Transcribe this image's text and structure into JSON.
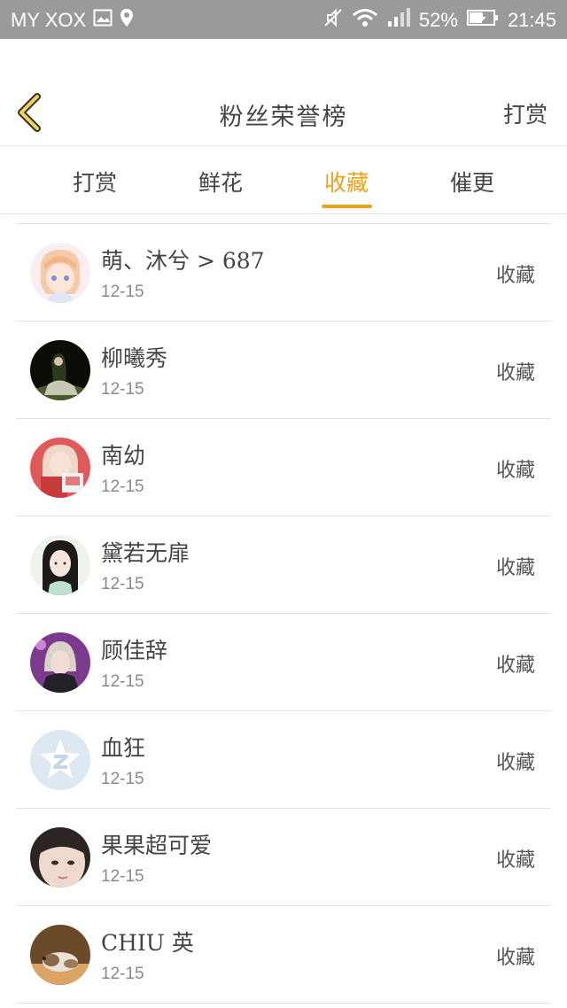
{
  "status_bar": {
    "carrier": "MY XOX",
    "battery": "52%",
    "time": "21:45",
    "icons": [
      "image-icon",
      "location-icon",
      "mute-icon",
      "wifi-icon",
      "signal-icon",
      "battery-icon"
    ]
  },
  "header": {
    "title": "粉丝荣誉榜",
    "action": "打赏",
    "back_icon": "chevron-left-icon"
  },
  "tabs": [
    {
      "label": "打赏",
      "active": false
    },
    {
      "label": "鲜花",
      "active": false
    },
    {
      "label": "收藏",
      "active": true
    },
    {
      "label": "催更",
      "active": false
    }
  ],
  "colors": {
    "accent": "#f0a019",
    "status_bar": "#9a9a9a"
  },
  "fans": [
    {
      "name": "萌、沐兮 > 687",
      "date": "12-15",
      "action": "收藏",
      "avatar": "anime-girl-avatar"
    },
    {
      "name": "柳曦秀",
      "date": "12-15",
      "action": "收藏",
      "avatar": "photo-avatar"
    },
    {
      "name": "南幼",
      "date": "12-15",
      "action": "收藏",
      "avatar": "photo-avatar"
    },
    {
      "name": "黛若无扉",
      "date": "12-15",
      "action": "收藏",
      "avatar": "photo-avatar"
    },
    {
      "name": "顾佳辞",
      "date": "12-15",
      "action": "收藏",
      "avatar": "photo-avatar"
    },
    {
      "name": "血狂",
      "date": "12-15",
      "action": "收藏",
      "avatar": "default-qq-avatar"
    },
    {
      "name": "果果超可爱",
      "date": "12-15",
      "action": "收藏",
      "avatar": "photo-avatar"
    },
    {
      "name": "CHIU 英",
      "date": "12-15",
      "action": "收藏",
      "avatar": "photo-avatar"
    }
  ]
}
